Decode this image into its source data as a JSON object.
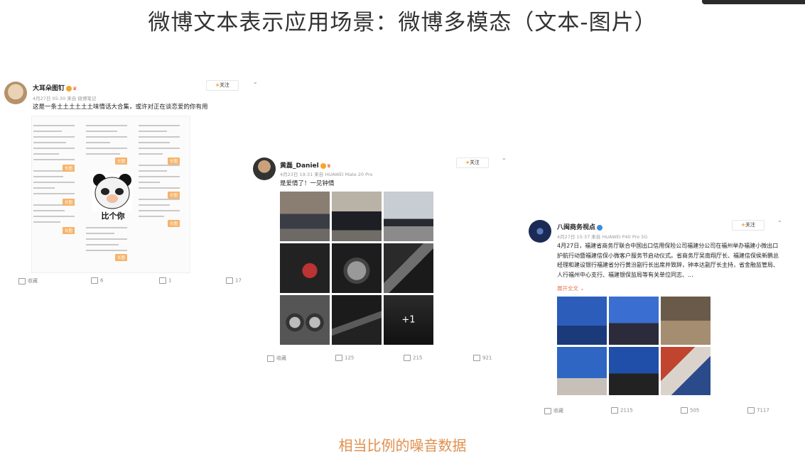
{
  "slide": {
    "title": "微博文本表示应用场景：微博多模态（文本-图片）",
    "caption": "相当比例的噪音数据"
  },
  "cards": [
    {
      "user": "大耳朵图钉",
      "meta": "4月27日 05:30 来自 微博笔记",
      "follow": "关注",
      "text": "这是一条土土土土土土味情话大合集，或许对正在谈恋爱的你有用",
      "image_tags": [
        "长图",
        "长图",
        "长图",
        "长图",
        "长图",
        "长图",
        "长图",
        "长图"
      ],
      "sticker_text": "比个你",
      "actions": {
        "favorite": "收藏",
        "repost": "6",
        "comment": "1",
        "like": "17"
      }
    },
    {
      "user": "黄磊_Daniel",
      "meta": "4月23日 19:31 来自 HUAWEI Mate 20 Pro",
      "follow": "关注",
      "text": "是爱情了！一见钟情",
      "more_overlay": "+1",
      "actions": {
        "favorite": "收藏",
        "repost": "125",
        "comment": "215",
        "like": "921"
      }
    },
    {
      "user": "八闽商务视点",
      "meta": "4月27日 15:37 来自 HUAWEI P40 Pro 5G",
      "follow": "关注",
      "text": "4月27日，福建省商务厅联合中国出口信用保险公司福建分公司在福州举办福建小微出口护航行动暨福建信保小微客户服务节启动仪式。省商务厅吴南翔厅长、福建信保侯新鹏总经理和建设银行福建省分行黄汾副行长出席并致辞，钟本达副厅长主持，省金融监管局、人行福州中心支行、福建银保监局等有关单位同志、...",
      "expand": "展开全文",
      "actions": {
        "favorite": "收藏",
        "repost": "2115",
        "comment": "505",
        "like": "7117"
      }
    }
  ],
  "colors": {
    "accent": "#ff8200",
    "caption": "#e0904e",
    "tag": "#f7b36b"
  }
}
